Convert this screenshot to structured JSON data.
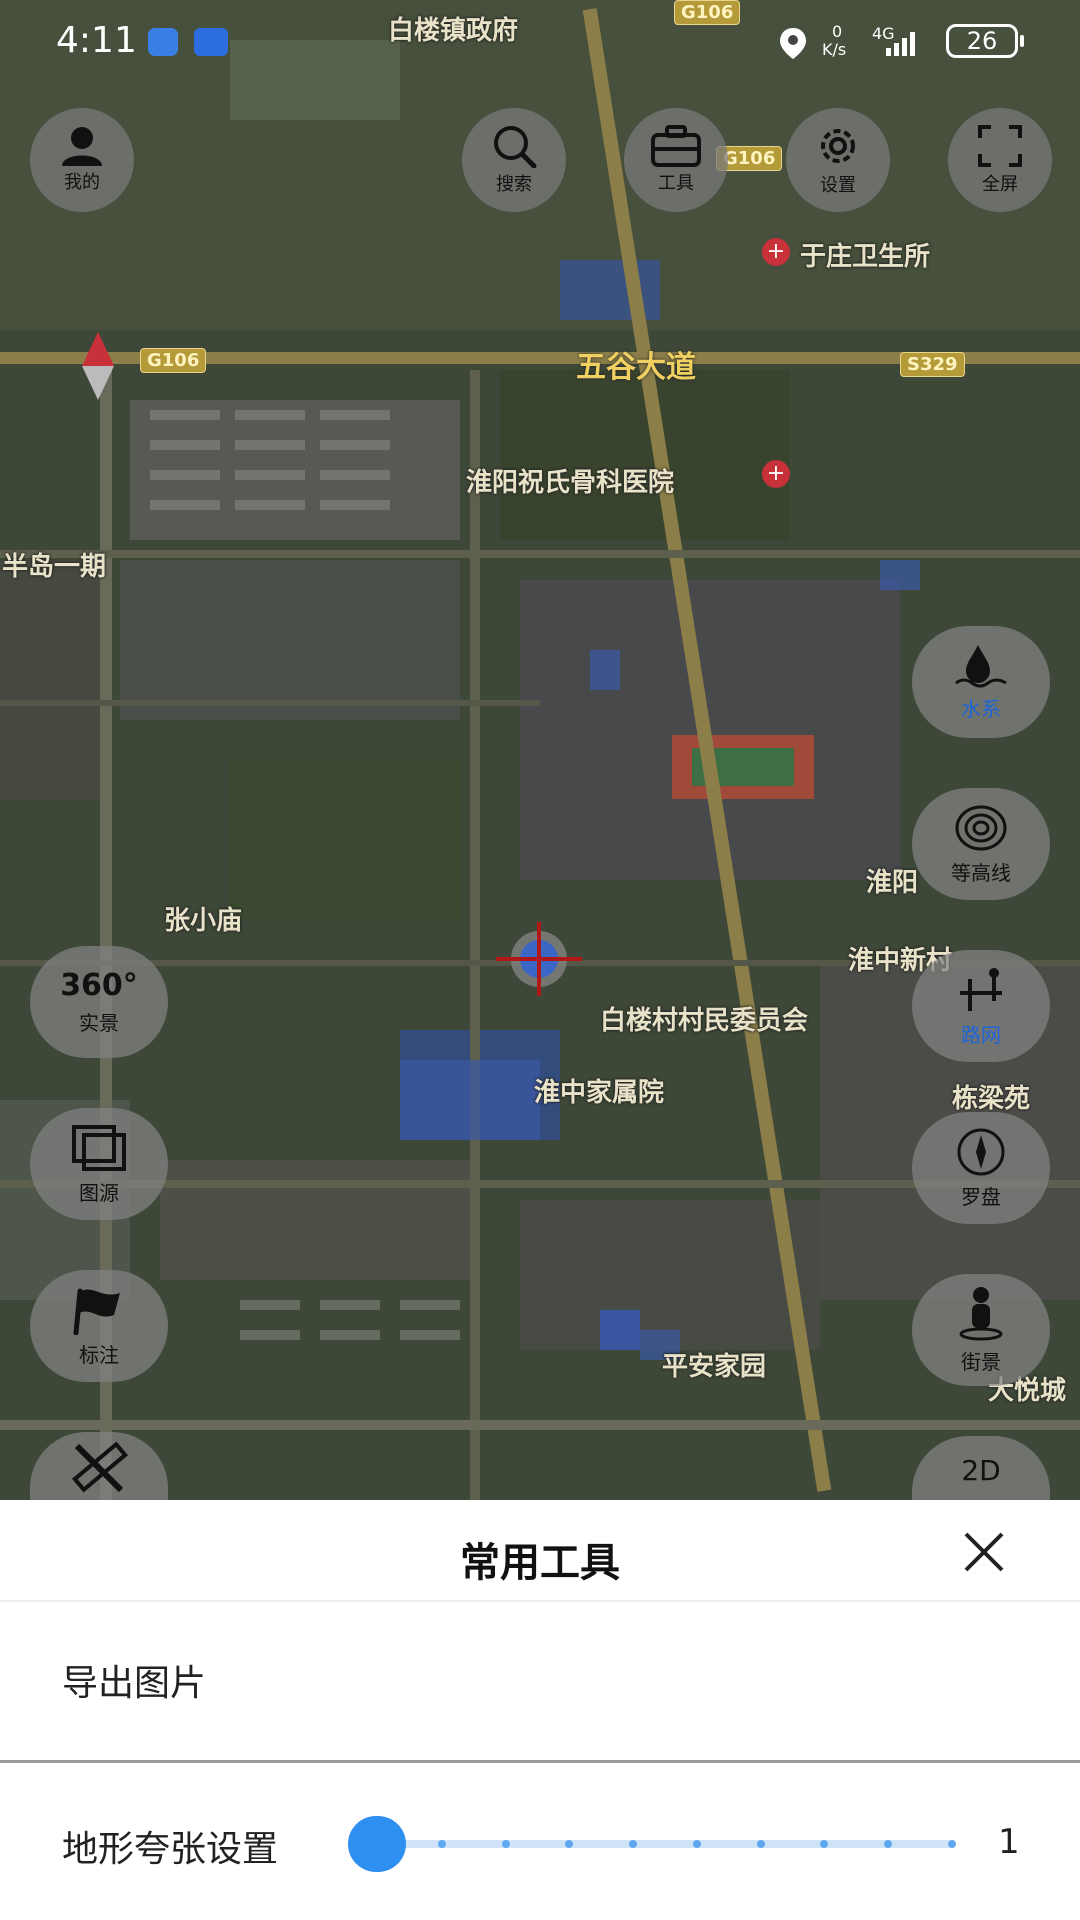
{
  "status_bar": {
    "time": "4:11",
    "net_speed_top": "0",
    "net_speed_unit": "K/s",
    "network": "4G",
    "battery": "26"
  },
  "top_buttons": {
    "mine": "我的",
    "search": "搜索",
    "tools": "工具",
    "settings": "设置",
    "fullscreen": "全屏"
  },
  "map_labels": {
    "baileu_gov": "白楼镇政府",
    "yuzhuang_clinic": "于庄卫生所",
    "wugu_road": "五谷大道",
    "hospital": "淮阳祝氏骨科医院",
    "bandao": "半岛一期",
    "zhangxiaomiao": "张小庙",
    "village_committee": "白楼村村民委员会",
    "huaizhong_home": "淮中家属院",
    "huaiyang": "淮阳",
    "huaizhong_new": "淮中新村",
    "dongliangyuan": "栋梁苑",
    "pingan": "平安家园",
    "dayue": "大悦城",
    "g106_top": "G106",
    "g106_right": "G106",
    "g106_left": "G106",
    "s329": "S329"
  },
  "left_buttons": {
    "panorama_big": "360°",
    "panorama": "实景",
    "source": "图源",
    "mark": "标注"
  },
  "right_buttons": {
    "water": "水系",
    "contour": "等高线",
    "roads": "路网",
    "compass": "罗盘",
    "street": "街景",
    "mode": "2D"
  },
  "sheet": {
    "title": "常用工具",
    "export_label": "导出图片",
    "terrain_label": "地形夸张设置",
    "terrain_value": "1",
    "terrain_level": 1,
    "terrain_min": 1,
    "terrain_max": 10
  },
  "colors": {
    "accent": "#2f8ff0",
    "slider_track": "#cfe4f8",
    "active_blue": "#1f66d6"
  }
}
